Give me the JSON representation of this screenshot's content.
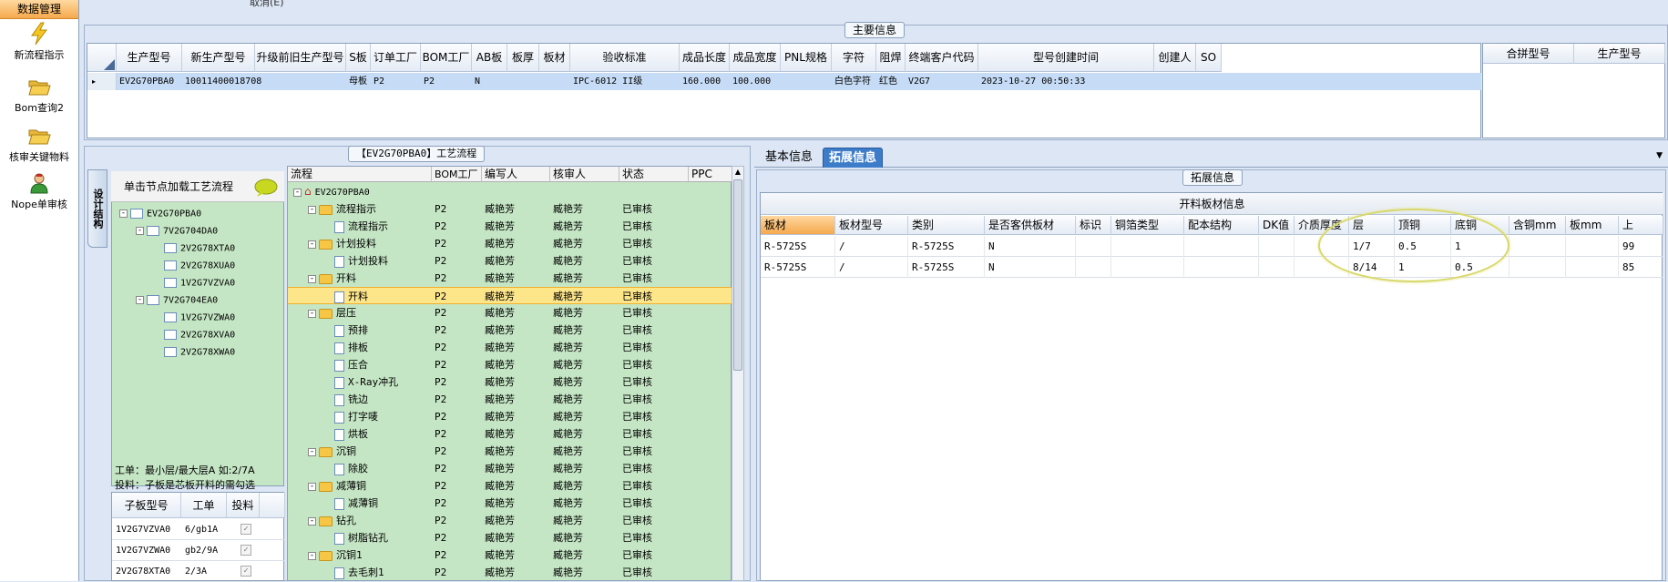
{
  "nav": {
    "header": "数据管理",
    "items": [
      {
        "label": "新流程指示",
        "icon": "lightning-icon"
      },
      {
        "label": "Bom查询2",
        "icon": "folder-open-icon"
      },
      {
        "label": "核审关键物料",
        "icon": "folder-open-icon"
      },
      {
        "label": "Nope单审核",
        "icon": "user-icon"
      }
    ]
  },
  "top_partial_text": "取消(E)",
  "main_info": {
    "title": "主要信息",
    "columns": [
      "生产型号",
      "新生产型号",
      "升级前旧生产型号",
      "S板",
      "订单工厂",
      "BOM工厂",
      "AB板",
      "板厚",
      "板材",
      "验收标准",
      "成品长度",
      "成品宽度",
      "PNL规格",
      "字符",
      "阻焊",
      "终端客户代码",
      "型号创建时间",
      "创建人",
      "SO"
    ],
    "row": [
      "EV2G70PBA0",
      "10011400018708",
      "",
      "母板",
      "P2",
      "P2",
      "N",
      "",
      "",
      "IPC-6012 II级",
      "160.000",
      "100.000",
      "",
      "白色字符",
      "红色",
      "V2G7",
      "2023-10-27 00:50:33",
      "",
      ""
    ],
    "side_columns": [
      "合拼型号",
      "生产型号"
    ]
  },
  "process": {
    "title": "【EV2G70PBA0】工艺流程",
    "vertical_tab": "设计结构",
    "hint": "单击节点加载工艺流程",
    "left_tree": [
      {
        "label": "EV2G70PBA0",
        "level": 0,
        "expander": "-"
      },
      {
        "label": "7V2G704DA0",
        "level": 1,
        "expander": "-"
      },
      {
        "label": "2V2G78XTA0",
        "level": 2
      },
      {
        "label": "2V2G78XUA0",
        "level": 2
      },
      {
        "label": "1V2G7VZVA0",
        "level": 2
      },
      {
        "label": "7V2G704EA0",
        "level": 1,
        "expander": "-"
      },
      {
        "label": "1V2G7VZWA0",
        "level": 2
      },
      {
        "label": "2V2G78XVA0",
        "level": 2
      },
      {
        "label": "2V2G78XWA0",
        "level": 2
      }
    ],
    "note_line1": "工单：最小层/最大层A 如:2/7A",
    "note_line2": "投料：子板是芯板开料的需勾选",
    "sub_columns": [
      "子板型号",
      "工单",
      "投料"
    ],
    "sub_rows": [
      {
        "model": "1V2G7VZVA0",
        "order": "6/gb1A",
        "checked": true
      },
      {
        "model": "1V2G7VZWA0",
        "order": "gb2/9A",
        "checked": true
      },
      {
        "model": "2V2G78XTA0",
        "order": "2/3A",
        "checked": true
      }
    ],
    "flow_columns": [
      "流程",
      "BOM工厂",
      "编写人",
      "核审人",
      "状态",
      "PPC"
    ],
    "flow_rows": [
      {
        "label": "EV2G70PBA0",
        "type": "home",
        "indent": 0,
        "factory": "",
        "writer": "",
        "reviewer": "",
        "status": "",
        "expander": "-"
      },
      {
        "label": "流程指示",
        "type": "folder",
        "indent": 1,
        "factory": "P2",
        "writer": "臧艳芳",
        "reviewer": "臧艳芳",
        "status": "已审核",
        "expander": "-"
      },
      {
        "label": "流程指示",
        "type": "doc",
        "indent": 2,
        "factory": "P2",
        "writer": "臧艳芳",
        "reviewer": "臧艳芳",
        "status": "已审核"
      },
      {
        "label": "计划投料",
        "type": "folder",
        "indent": 1,
        "factory": "P2",
        "writer": "臧艳芳",
        "reviewer": "臧艳芳",
        "status": "已审核",
        "expander": "-"
      },
      {
        "label": "计划投料",
        "type": "doc",
        "indent": 2,
        "factory": "P2",
        "writer": "臧艳芳",
        "reviewer": "臧艳芳",
        "status": "已审核"
      },
      {
        "label": "开料",
        "type": "folder",
        "indent": 1,
        "factory": "P2",
        "writer": "臧艳芳",
        "reviewer": "臧艳芳",
        "status": "已审核",
        "expander": "-"
      },
      {
        "label": "开料",
        "type": "doc",
        "indent": 2,
        "factory": "P2",
        "writer": "臧艳芳",
        "reviewer": "臧艳芳",
        "status": "已审核",
        "selected": true
      },
      {
        "label": "层压",
        "type": "folder",
        "indent": 1,
        "factory": "P2",
        "writer": "臧艳芳",
        "reviewer": "臧艳芳",
        "status": "已审核",
        "expander": "-"
      },
      {
        "label": "预排",
        "type": "doc",
        "indent": 2,
        "factory": "P2",
        "writer": "臧艳芳",
        "reviewer": "臧艳芳",
        "status": "已审核"
      },
      {
        "label": "排板",
        "type": "doc",
        "indent": 2,
        "factory": "P2",
        "writer": "臧艳芳",
        "reviewer": "臧艳芳",
        "status": "已审核"
      },
      {
        "label": "压合",
        "type": "doc",
        "indent": 2,
        "factory": "P2",
        "writer": "臧艳芳",
        "reviewer": "臧艳芳",
        "status": "已审核"
      },
      {
        "label": "X-Ray冲孔",
        "type": "doc",
        "indent": 2,
        "factory": "P2",
        "writer": "臧艳芳",
        "reviewer": "臧艳芳",
        "status": "已审核"
      },
      {
        "label": "铣边",
        "type": "doc",
        "indent": 2,
        "factory": "P2",
        "writer": "臧艳芳",
        "reviewer": "臧艳芳",
        "status": "已审核"
      },
      {
        "label": "打字唛",
        "type": "doc",
        "indent": 2,
        "factory": "P2",
        "writer": "臧艳芳",
        "reviewer": "臧艳芳",
        "status": "已审核"
      },
      {
        "label": "烘板",
        "type": "doc",
        "indent": 2,
        "factory": "P2",
        "writer": "臧艳芳",
        "reviewer": "臧艳芳",
        "status": "已审核"
      },
      {
        "label": "沉铜",
        "type": "folder",
        "indent": 1,
        "factory": "P2",
        "writer": "臧艳芳",
        "reviewer": "臧艳芳",
        "status": "已审核",
        "expander": "-"
      },
      {
        "label": "除胶",
        "type": "doc",
        "indent": 2,
        "factory": "P2",
        "writer": "臧艳芳",
        "reviewer": "臧艳芳",
        "status": "已审核"
      },
      {
        "label": "减薄铜",
        "type": "folder",
        "indent": 1,
        "factory": "P2",
        "writer": "臧艳芳",
        "reviewer": "臧艳芳",
        "status": "已审核",
        "expander": "-"
      },
      {
        "label": "减薄铜",
        "type": "doc",
        "indent": 2,
        "factory": "P2",
        "writer": "臧艳芳",
        "reviewer": "臧艳芳",
        "status": "已审核"
      },
      {
        "label": "钻孔",
        "type": "folder",
        "indent": 1,
        "factory": "P2",
        "writer": "臧艳芳",
        "reviewer": "臧艳芳",
        "status": "已审核",
        "expander": "-"
      },
      {
        "label": "树脂钻孔",
        "type": "doc",
        "indent": 2,
        "factory": "P2",
        "writer": "臧艳芳",
        "reviewer": "臧艳芳",
        "status": "已审核"
      },
      {
        "label": "沉铜1",
        "type": "folder",
        "indent": 1,
        "factory": "P2",
        "writer": "臧艳芳",
        "reviewer": "臧艳芳",
        "status": "已审核",
        "expander": "-"
      },
      {
        "label": "去毛刺1",
        "type": "doc",
        "indent": 2,
        "factory": "P2",
        "writer": "臧艳芳",
        "reviewer": "臧艳芳",
        "status": "已审核"
      }
    ]
  },
  "right": {
    "tabs": [
      "基本信息",
      "拓展信息"
    ],
    "active_tab": "拓展信息",
    "group_title": "拓展信息",
    "grid_title": "开料板材信息",
    "columns": [
      "板材",
      "板材型号",
      "类别",
      "是否客供板材",
      "标识",
      "铜箔类型",
      "配本结构",
      "DK值",
      "介质厚度",
      "层",
      "顶铜",
      "底铜",
      "含铜mm",
      "板mm",
      "上"
    ],
    "rows": [
      [
        "R-5725S",
        "/",
        "R-5725S",
        "N",
        "",
        "",
        "",
        "",
        "",
        "1/7",
        "0.5",
        "1",
        "",
        "",
        "99"
      ],
      [
        "R-5725S",
        "/",
        "R-5725S",
        "N",
        "",
        "",
        "",
        "",
        "",
        "8/14",
        "1",
        "0.5",
        "",
        "",
        "85"
      ]
    ]
  },
  "colors": {
    "accent_orange": "#f5a94d",
    "selected_row": "#c6dcf6",
    "tree_bg": "#c5e6c5",
    "highlight_row": "#fde58a",
    "active_tab": "#3d7cc9",
    "annotation_ellipse": "#d8d86a"
  }
}
